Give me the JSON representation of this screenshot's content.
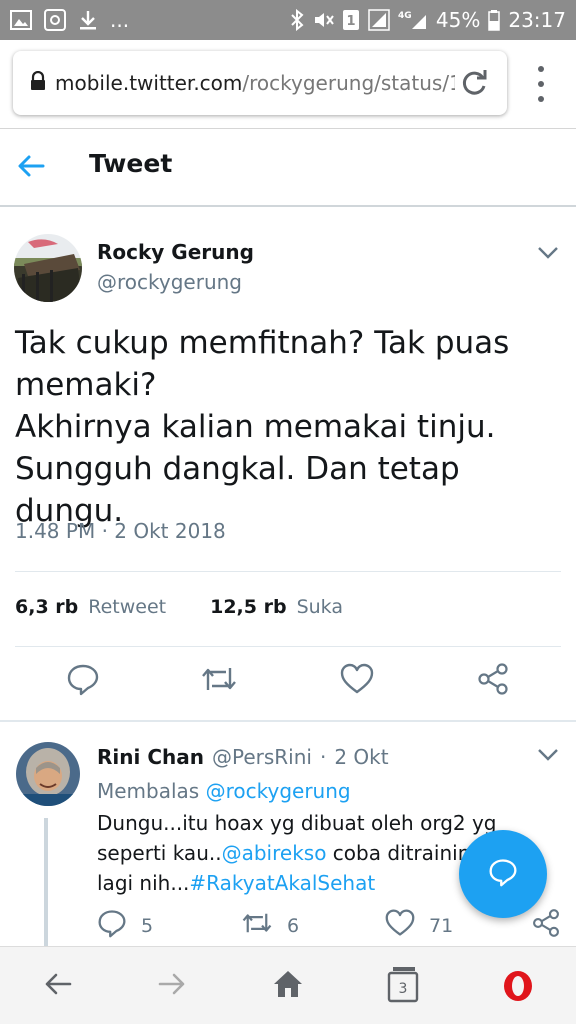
{
  "status_bar": {
    "battery": "45%",
    "time": "23:17",
    "notif_ellipsis": "...",
    "sim_label": "1",
    "network_label": "4G"
  },
  "browser": {
    "url_host": "mobile.twitter.com",
    "url_path": "/rockygerung/status/1"
  },
  "header": {
    "title": "Tweet"
  },
  "tweet": {
    "author_name": "Rocky Gerung",
    "author_handle": "@rockygerung",
    "text": "Tak cukup memfitnah? Tak puas memaki?\nAkhirnya kalian memakai tinju.\nSungguh dangkal. Dan tetap dungu.",
    "timestamp": "1.48 PM · 2 Okt 2018",
    "retweet_count": "6,3 rb",
    "retweet_label": "Retweet",
    "like_count": "12,5 rb",
    "like_label": "Suka"
  },
  "reply": {
    "author_name": "Rini Chan",
    "author_handle": "@PersRini",
    "dot": "·",
    "date": "2 Okt",
    "replying_prefix": "Membalas",
    "replying_to": "@rockygerung",
    "text_1": "Dungu...itu hoax yg dibuat oleh org2 yg seperti kau..",
    "mention": "@abirekso",
    "text_2": " coba ditraining lagi nih...",
    "hashtag": "#RakyatAkalSehat",
    "reply_count": "5",
    "retweet_count": "6",
    "like_count": "71"
  },
  "bottom_nav": {
    "tab_count": "3"
  },
  "colors": {
    "twitter_blue": "#1da1f2",
    "secondary_text": "#657786",
    "status_bar": "#8c8c8c",
    "opera_red": "#e0151b"
  },
  "icons": {
    "back": "arrow-left-icon",
    "chevron": "chevron-down-icon",
    "reply": "speech-bubble-icon",
    "retweet": "retweet-icon",
    "like": "heart-icon",
    "share": "share-icon",
    "compose": "compose-bubble-icon"
  }
}
